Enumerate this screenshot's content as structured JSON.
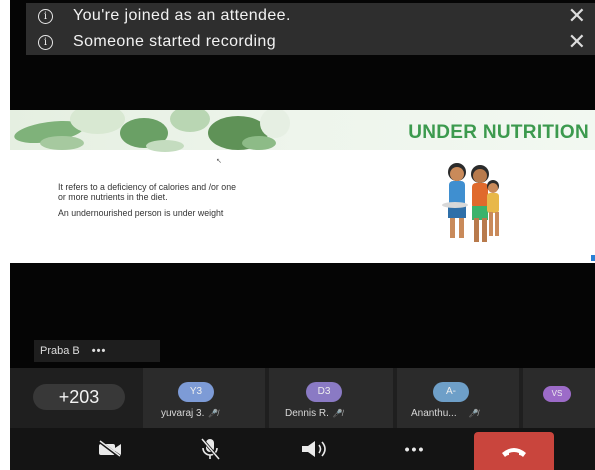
{
  "notifications": [
    {
      "message": "You're joined as an attendee."
    },
    {
      "message": "Someone started recording"
    }
  ],
  "slide": {
    "title": "UNDER NUTRITION",
    "line1": "It refers to a deficiency of calories and /or one",
    "line2": "or more nutrients in the diet.",
    "line3": "An undernourished person is under weight"
  },
  "presenter": {
    "name": "Praba B",
    "more": "•••"
  },
  "participants": {
    "count": "+203",
    "list": [
      {
        "initials": "Y3",
        "name": "yuvaraj 3.",
        "color": "#7d9bd6"
      },
      {
        "initials": "D3",
        "name": "Dennis R.",
        "color": "#8a7ac4"
      },
      {
        "initials": "A-",
        "name": "Ananthu...",
        "color": "#6e9fc8"
      },
      {
        "initials": "VS",
        "name": "",
        "color": "#9c6bc8"
      }
    ]
  },
  "controls": {
    "more": "•••"
  },
  "colors": {
    "end_call": "#c9453d",
    "title_green": "#3c9a4e"
  }
}
